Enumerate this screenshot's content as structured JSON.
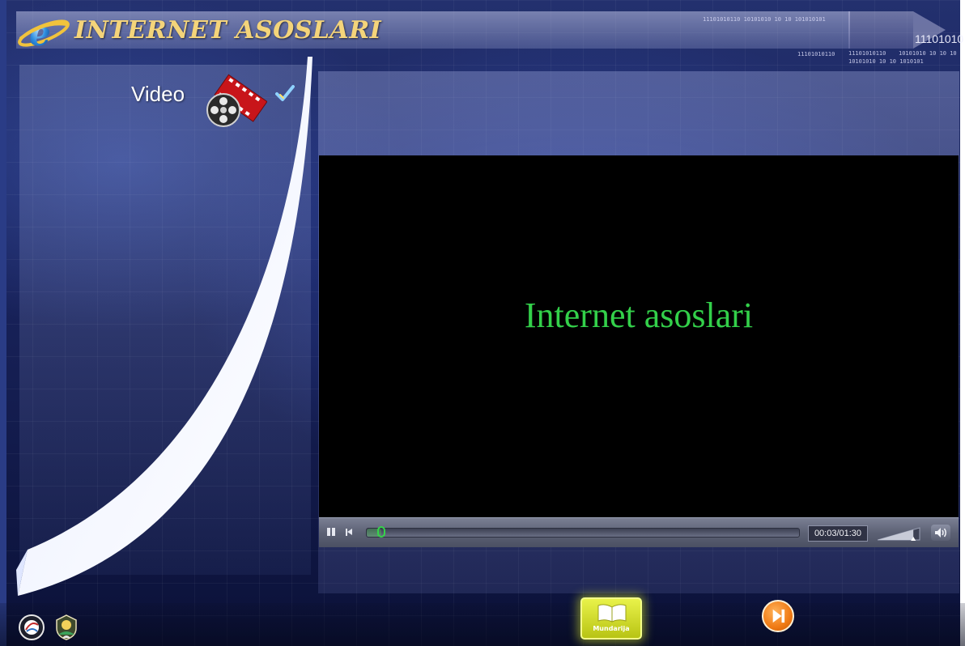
{
  "header": {
    "title": "INTERNET ASOSLARI",
    "binary_top": "11101010110   10101010   10 10 101010101",
    "binary_big": "11101010",
    "binary_line1_left": "11101010110",
    "binary_line1_right": "10101010  10 10 10",
    "binary_line2_left": "11101010110",
    "binary_line2_right": "10101010  10 10 1010101"
  },
  "sidebar": {
    "section_label": "Video"
  },
  "player": {
    "video_title": "Internet asoslari",
    "time_display": "00:03/01:30",
    "progress_fraction": 0.034,
    "volume_fraction": 0.85,
    "state": "playing"
  },
  "bottom": {
    "toc_label": "Mundarija"
  },
  "colors": {
    "title": "#f4d47a",
    "video_text": "#33d04a",
    "toc_button": "#d9e32a",
    "next_button": "#f07a14"
  },
  "icons": [
    "ie-logo-icon",
    "video-film-icon",
    "check-icon",
    "pause-icon",
    "restart-icon",
    "volume-icon",
    "book-icon",
    "next-icon",
    "logo-icon"
  ]
}
